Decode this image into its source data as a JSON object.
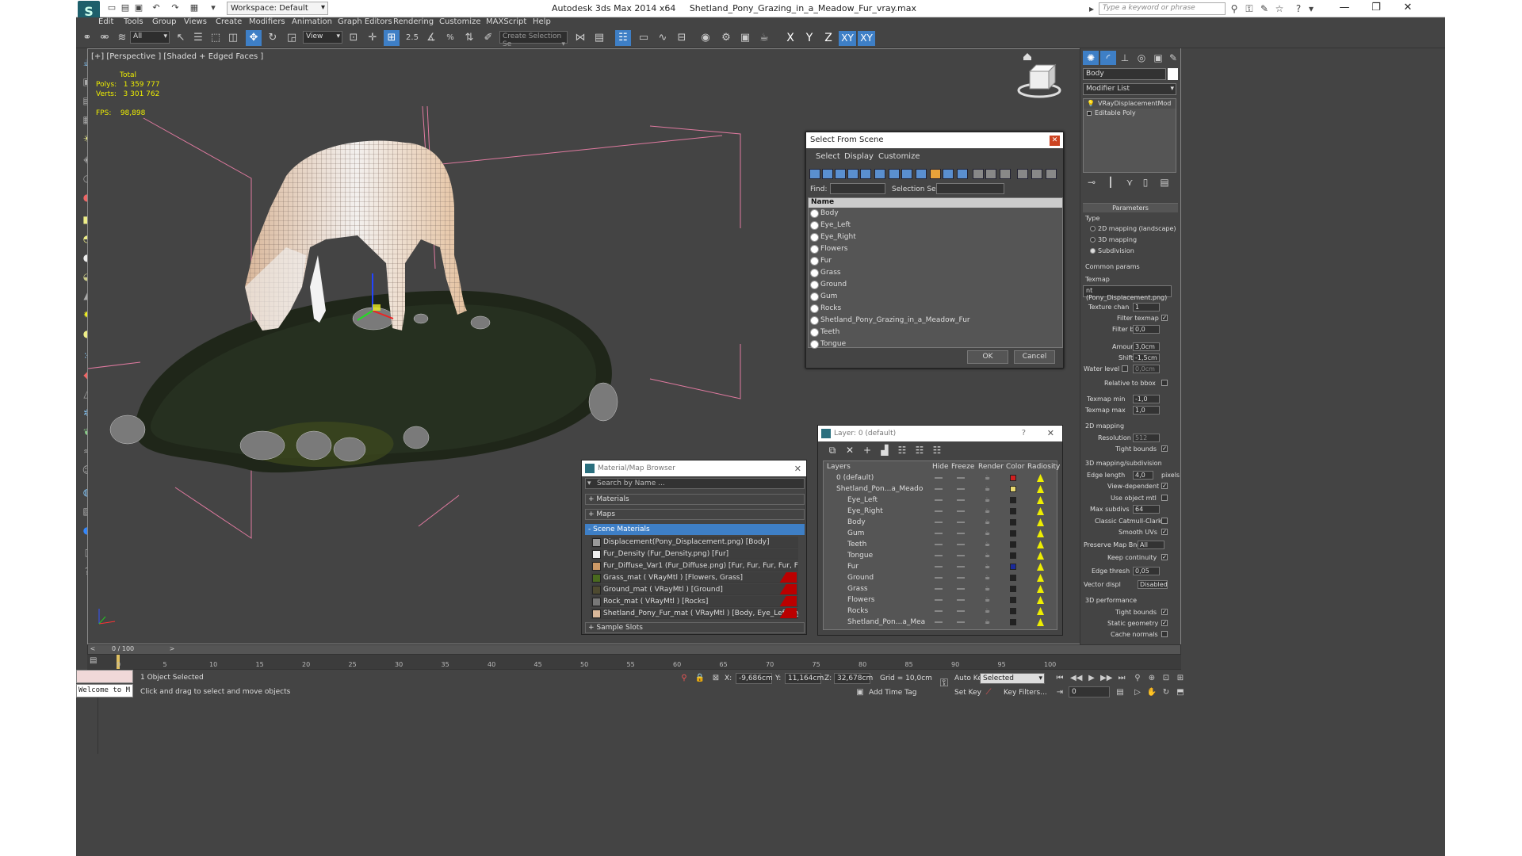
{
  "title": {
    "app": "Autodesk 3ds Max  2014 x64",
    "file": "Shetland_Pony_Grazing_in_a_Meadow_Fur_vray.max",
    "workspace": "Workspace: Default",
    "search_placeholder": "Type a keyword or phrase"
  },
  "menu": [
    "Edit",
    "Tools",
    "Group",
    "Views",
    "Create",
    "Modifiers",
    "Animation",
    "Graph Editors",
    "Rendering",
    "Customize",
    "MAXScript",
    "Help"
  ],
  "toolbar": {
    "filter": "All",
    "refcoord": "View",
    "snap_angle": "2.5",
    "snap_percent": "%",
    "selection_set": "Create Selection Se",
    "axes": [
      "X",
      "Y",
      "Z",
      "XY",
      "XY"
    ]
  },
  "viewport": {
    "label": "[+] [Perspective ] [Shaded + Edged Faces ]",
    "stats_total": "Total",
    "polys_label": "Polys:",
    "polys_value": "1 359 777",
    "verts_label": "Verts:",
    "verts_value": "3 301 762",
    "fps_label": "FPS:",
    "fps_value": "98,898"
  },
  "select_from_scene": {
    "title": "Select From Scene",
    "menu": [
      "Select",
      "Display",
      "Customize"
    ],
    "find_label": "Find:",
    "selection_set_label": "Selection Set:",
    "column_name": "Name",
    "items": [
      "Body",
      "Eye_Left",
      "Eye_Right",
      "Flowers",
      "Fur",
      "Grass",
      "Ground",
      "Gum",
      "Rocks",
      "Shetland_Pony_Grazing_in_a_Meadow_Fur",
      "Teeth",
      "Tongue"
    ],
    "ok": "OK",
    "cancel": "Cancel"
  },
  "material_browser": {
    "title": "Material/Map Browser",
    "search": "Search by Name ...",
    "groups": [
      "+ Materials",
      "+ Maps",
      "- Scene Materials",
      "+ Sample Slots"
    ],
    "scene_materials": [
      "Displacement(Pony_Displacement.png) [Body]",
      "Fur_Density (Fur_Density.png) [Fur]",
      "Fur_Diffuse_Var1 (Fur_Diffuse.png) [Fur, Fur, Fur, Fur, Fur]",
      "Grass_mat  ( VRayMtl ) [Flowers, Grass]",
      "Ground_mat  ( VRayMtl ) [Ground]",
      "Rock_mat  ( VRayMtl ) [Rocks]",
      "Shetland_Pony_Fur_mat  ( VRayMtl ) [Body, Eye_Left, Eye_Rig..."
    ]
  },
  "layer_dialog": {
    "title": "Layer: 0 (default)",
    "help": "?",
    "columns": [
      "Layers",
      "Hide",
      "Freeze",
      "Render",
      "Color",
      "Radiosity"
    ],
    "rows": [
      {
        "name": "0 (default)",
        "color": "#d02020"
      },
      {
        "name": "Shetland_Pon...a_Meado",
        "color": "#e8d870"
      },
      {
        "name": "Eye_Left",
        "color": "#222222"
      },
      {
        "name": "Eye_Right",
        "color": "#222222"
      },
      {
        "name": "Body",
        "color": "#222222"
      },
      {
        "name": "Gum",
        "color": "#222222"
      },
      {
        "name": "Teeth",
        "color": "#222222"
      },
      {
        "name": "Tongue",
        "color": "#222222"
      },
      {
        "name": "Fur",
        "color": "#1a2a9a"
      },
      {
        "name": "Ground",
        "color": "#222222"
      },
      {
        "name": "Grass",
        "color": "#222222"
      },
      {
        "name": "Flowers",
        "color": "#222222"
      },
      {
        "name": "Rocks",
        "color": "#222222"
      },
      {
        "name": "Shetland_Pon...a_Mea",
        "color": "#222222"
      }
    ]
  },
  "command_panel": {
    "object_name": "Body",
    "modifier_list": "Modifier List",
    "stack": [
      "VRayDisplacementMod",
      "Editable Poly"
    ],
    "parameters": "Parameters",
    "type_label": "Type",
    "type_options": [
      "2D mapping (landscape)",
      "3D mapping",
      "Subdivision"
    ],
    "common_params": "Common params",
    "texmap_label": "Texmap",
    "texmap_value": "nt (Pony_Displacement.png)",
    "texture_chan_label": "Texture chan",
    "texture_chan": "1",
    "filter_texmap": "Filter texmap",
    "filter_blur_label": "Filter blur",
    "filter_blur": "0,0",
    "amount_label": "Amount",
    "amount": "3,0cm",
    "shift_label": "Shift",
    "shift": "-1,5cm",
    "water_level_label": "Water level",
    "water_level": "0,0cm",
    "relative_bbox": "Relative to bbox",
    "texmap_min_label": "Texmap min",
    "texmap_min": "-1,0",
    "texmap_max_label": "Texmap max",
    "texmap_max": "1,0",
    "mapping2d": "2D mapping",
    "resolution_label": "Resolution",
    "resolution": "512",
    "tight_bounds": "Tight bounds",
    "mapping3d": "3D mapping/subdivision",
    "edge_length_label": "Edge length",
    "edge_length": "4,0",
    "pixels": "pixels",
    "view_dependent": "View-dependent",
    "use_object_mtl": "Use object mtl",
    "max_subdivs_label": "Max subdivs",
    "max_subdivs": "64",
    "classic_catmull": "Classic Catmull-Clark",
    "smooth_uvs": "Smooth UVs",
    "preserve_map_bnd_label": "Preserve Map Bnd",
    "preserve_map_bnd": "All",
    "keep_continuity": "Keep continuity",
    "edge_thresh_label": "Edge thresh",
    "edge_thresh": "0,05",
    "vector_displ_label": "Vector displ",
    "vector_displ": "Disabled",
    "perf": "3D performance",
    "perf_tight_bounds": "Tight bounds",
    "static_geometry": "Static geometry",
    "cache_normals": "Cache normals"
  },
  "timeline": {
    "frame": "0 / 100",
    "ticks": [
      "0",
      "5",
      "10",
      "15",
      "20",
      "25",
      "30",
      "35",
      "40",
      "45",
      "50",
      "55",
      "60",
      "65",
      "70",
      "75",
      "80",
      "85",
      "90",
      "95",
      "100"
    ]
  },
  "status": {
    "maxscript": "Welcome to M",
    "selected": "1 Object Selected",
    "prompt": "Click and drag to select and move objects",
    "x_label": "X:",
    "x": "-9,686cm",
    "y_label": "Y:",
    "y": "11,164cm",
    "z_label": "Z:",
    "z": "32,678cm",
    "grid": "Grid = 10,0cm",
    "add_time_tag": "Add Time Tag",
    "auto_key": "Auto Key",
    "set_key": "Set Key",
    "selected_dd": "Selected",
    "key_filters": "Key Filters...",
    "frame_field": "0"
  }
}
